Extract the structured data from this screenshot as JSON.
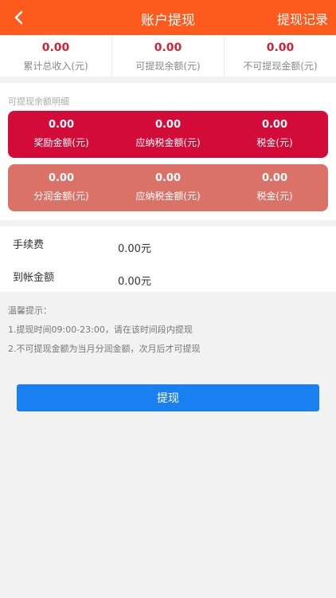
{
  "header": {
    "title": "账户提现",
    "right_link": "提现记录"
  },
  "summary": [
    {
      "value": "0.00",
      "label": "累计总收入(元)"
    },
    {
      "value": "0.00",
      "label": "可提现余额(元)"
    },
    {
      "value": "0.00",
      "label": "不可提现金额(元)"
    }
  ],
  "detail": {
    "title": "可提现余额明细",
    "card1": [
      {
        "value": "0.00",
        "label": "奖励金额(元)"
      },
      {
        "value": "0.00",
        "label": "应纳税金额(元)"
      },
      {
        "value": "0.00",
        "label": "税金(元)"
      }
    ],
    "card2": [
      {
        "value": "0.00",
        "label": "分润金额(元)"
      },
      {
        "value": "0.00",
        "label": "应纳税金额(元)"
      },
      {
        "value": "0.00",
        "label": "税金(元)"
      }
    ]
  },
  "fees": {
    "fee_label": "手续费",
    "fee_value": "0.00元",
    "arrival_label": "到帐金额",
    "arrival_value": "0.00元"
  },
  "tips": {
    "title": "温馨提示：",
    "line1": "1.提现时间09:00-23:00，请在该时间段内提现",
    "line2": "2.不可提现金额为当月分润金额，次月后才可提现"
  },
  "submit_label": "提现",
  "colors": {
    "header": "#ff5a1e",
    "card1": "#d20b38",
    "card2": "#db7268",
    "button": "#1a7ff0",
    "summary_value": "#d4203b"
  }
}
